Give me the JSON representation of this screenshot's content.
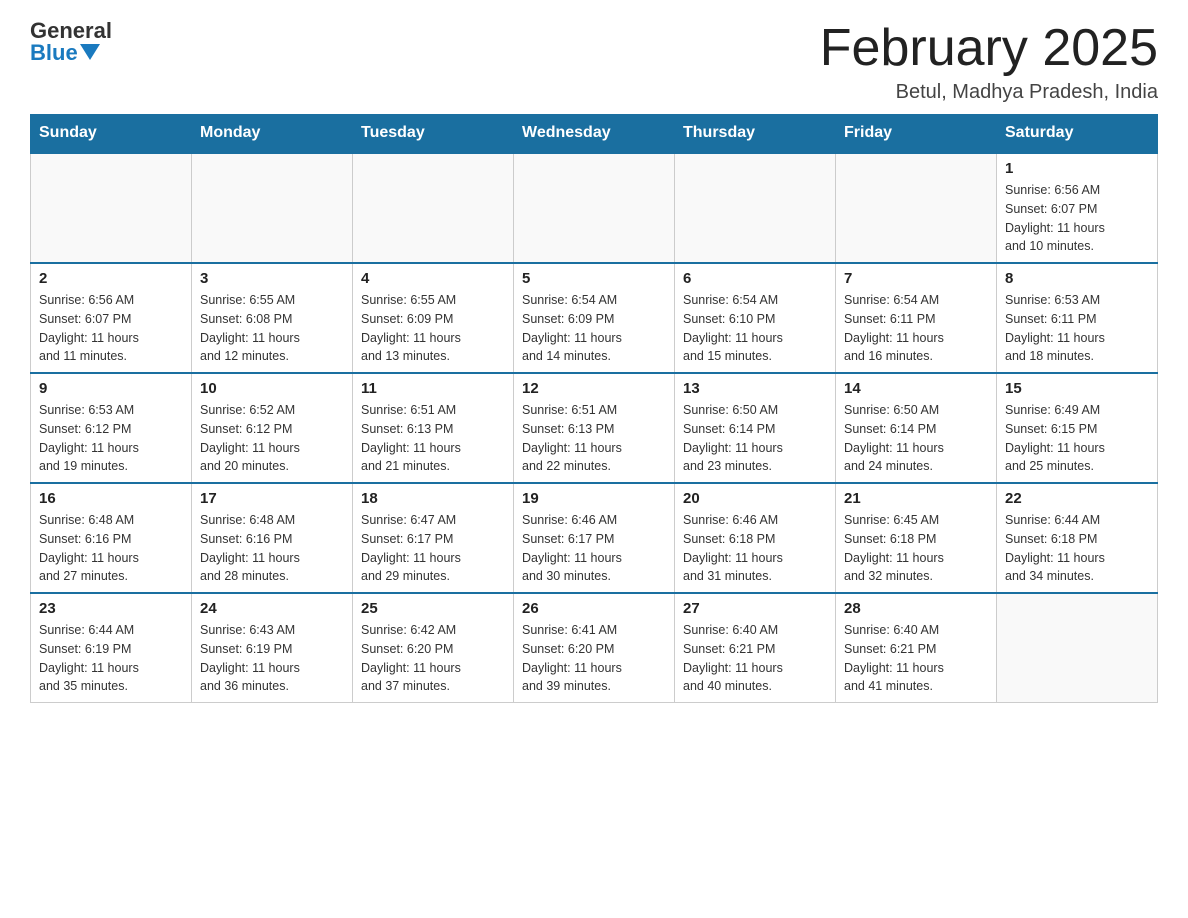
{
  "header": {
    "logo_general": "General",
    "logo_blue": "Blue",
    "month_title": "February 2025",
    "location": "Betul, Madhya Pradesh, India"
  },
  "days_of_week": [
    "Sunday",
    "Monday",
    "Tuesday",
    "Wednesday",
    "Thursday",
    "Friday",
    "Saturday"
  ],
  "weeks": [
    [
      {
        "day": "",
        "info": ""
      },
      {
        "day": "",
        "info": ""
      },
      {
        "day": "",
        "info": ""
      },
      {
        "day": "",
        "info": ""
      },
      {
        "day": "",
        "info": ""
      },
      {
        "day": "",
        "info": ""
      },
      {
        "day": "1",
        "info": "Sunrise: 6:56 AM\nSunset: 6:07 PM\nDaylight: 11 hours\nand 10 minutes."
      }
    ],
    [
      {
        "day": "2",
        "info": "Sunrise: 6:56 AM\nSunset: 6:07 PM\nDaylight: 11 hours\nand 11 minutes."
      },
      {
        "day": "3",
        "info": "Sunrise: 6:55 AM\nSunset: 6:08 PM\nDaylight: 11 hours\nand 12 minutes."
      },
      {
        "day": "4",
        "info": "Sunrise: 6:55 AM\nSunset: 6:09 PM\nDaylight: 11 hours\nand 13 minutes."
      },
      {
        "day": "5",
        "info": "Sunrise: 6:54 AM\nSunset: 6:09 PM\nDaylight: 11 hours\nand 14 minutes."
      },
      {
        "day": "6",
        "info": "Sunrise: 6:54 AM\nSunset: 6:10 PM\nDaylight: 11 hours\nand 15 minutes."
      },
      {
        "day": "7",
        "info": "Sunrise: 6:54 AM\nSunset: 6:11 PM\nDaylight: 11 hours\nand 16 minutes."
      },
      {
        "day": "8",
        "info": "Sunrise: 6:53 AM\nSunset: 6:11 PM\nDaylight: 11 hours\nand 18 minutes."
      }
    ],
    [
      {
        "day": "9",
        "info": "Sunrise: 6:53 AM\nSunset: 6:12 PM\nDaylight: 11 hours\nand 19 minutes."
      },
      {
        "day": "10",
        "info": "Sunrise: 6:52 AM\nSunset: 6:12 PM\nDaylight: 11 hours\nand 20 minutes."
      },
      {
        "day": "11",
        "info": "Sunrise: 6:51 AM\nSunset: 6:13 PM\nDaylight: 11 hours\nand 21 minutes."
      },
      {
        "day": "12",
        "info": "Sunrise: 6:51 AM\nSunset: 6:13 PM\nDaylight: 11 hours\nand 22 minutes."
      },
      {
        "day": "13",
        "info": "Sunrise: 6:50 AM\nSunset: 6:14 PM\nDaylight: 11 hours\nand 23 minutes."
      },
      {
        "day": "14",
        "info": "Sunrise: 6:50 AM\nSunset: 6:14 PM\nDaylight: 11 hours\nand 24 minutes."
      },
      {
        "day": "15",
        "info": "Sunrise: 6:49 AM\nSunset: 6:15 PM\nDaylight: 11 hours\nand 25 minutes."
      }
    ],
    [
      {
        "day": "16",
        "info": "Sunrise: 6:48 AM\nSunset: 6:16 PM\nDaylight: 11 hours\nand 27 minutes."
      },
      {
        "day": "17",
        "info": "Sunrise: 6:48 AM\nSunset: 6:16 PM\nDaylight: 11 hours\nand 28 minutes."
      },
      {
        "day": "18",
        "info": "Sunrise: 6:47 AM\nSunset: 6:17 PM\nDaylight: 11 hours\nand 29 minutes."
      },
      {
        "day": "19",
        "info": "Sunrise: 6:46 AM\nSunset: 6:17 PM\nDaylight: 11 hours\nand 30 minutes."
      },
      {
        "day": "20",
        "info": "Sunrise: 6:46 AM\nSunset: 6:18 PM\nDaylight: 11 hours\nand 31 minutes."
      },
      {
        "day": "21",
        "info": "Sunrise: 6:45 AM\nSunset: 6:18 PM\nDaylight: 11 hours\nand 32 minutes."
      },
      {
        "day": "22",
        "info": "Sunrise: 6:44 AM\nSunset: 6:18 PM\nDaylight: 11 hours\nand 34 minutes."
      }
    ],
    [
      {
        "day": "23",
        "info": "Sunrise: 6:44 AM\nSunset: 6:19 PM\nDaylight: 11 hours\nand 35 minutes."
      },
      {
        "day": "24",
        "info": "Sunrise: 6:43 AM\nSunset: 6:19 PM\nDaylight: 11 hours\nand 36 minutes."
      },
      {
        "day": "25",
        "info": "Sunrise: 6:42 AM\nSunset: 6:20 PM\nDaylight: 11 hours\nand 37 minutes."
      },
      {
        "day": "26",
        "info": "Sunrise: 6:41 AM\nSunset: 6:20 PM\nDaylight: 11 hours\nand 39 minutes."
      },
      {
        "day": "27",
        "info": "Sunrise: 6:40 AM\nSunset: 6:21 PM\nDaylight: 11 hours\nand 40 minutes."
      },
      {
        "day": "28",
        "info": "Sunrise: 6:40 AM\nSunset: 6:21 PM\nDaylight: 11 hours\nand 41 minutes."
      },
      {
        "day": "",
        "info": ""
      }
    ]
  ]
}
